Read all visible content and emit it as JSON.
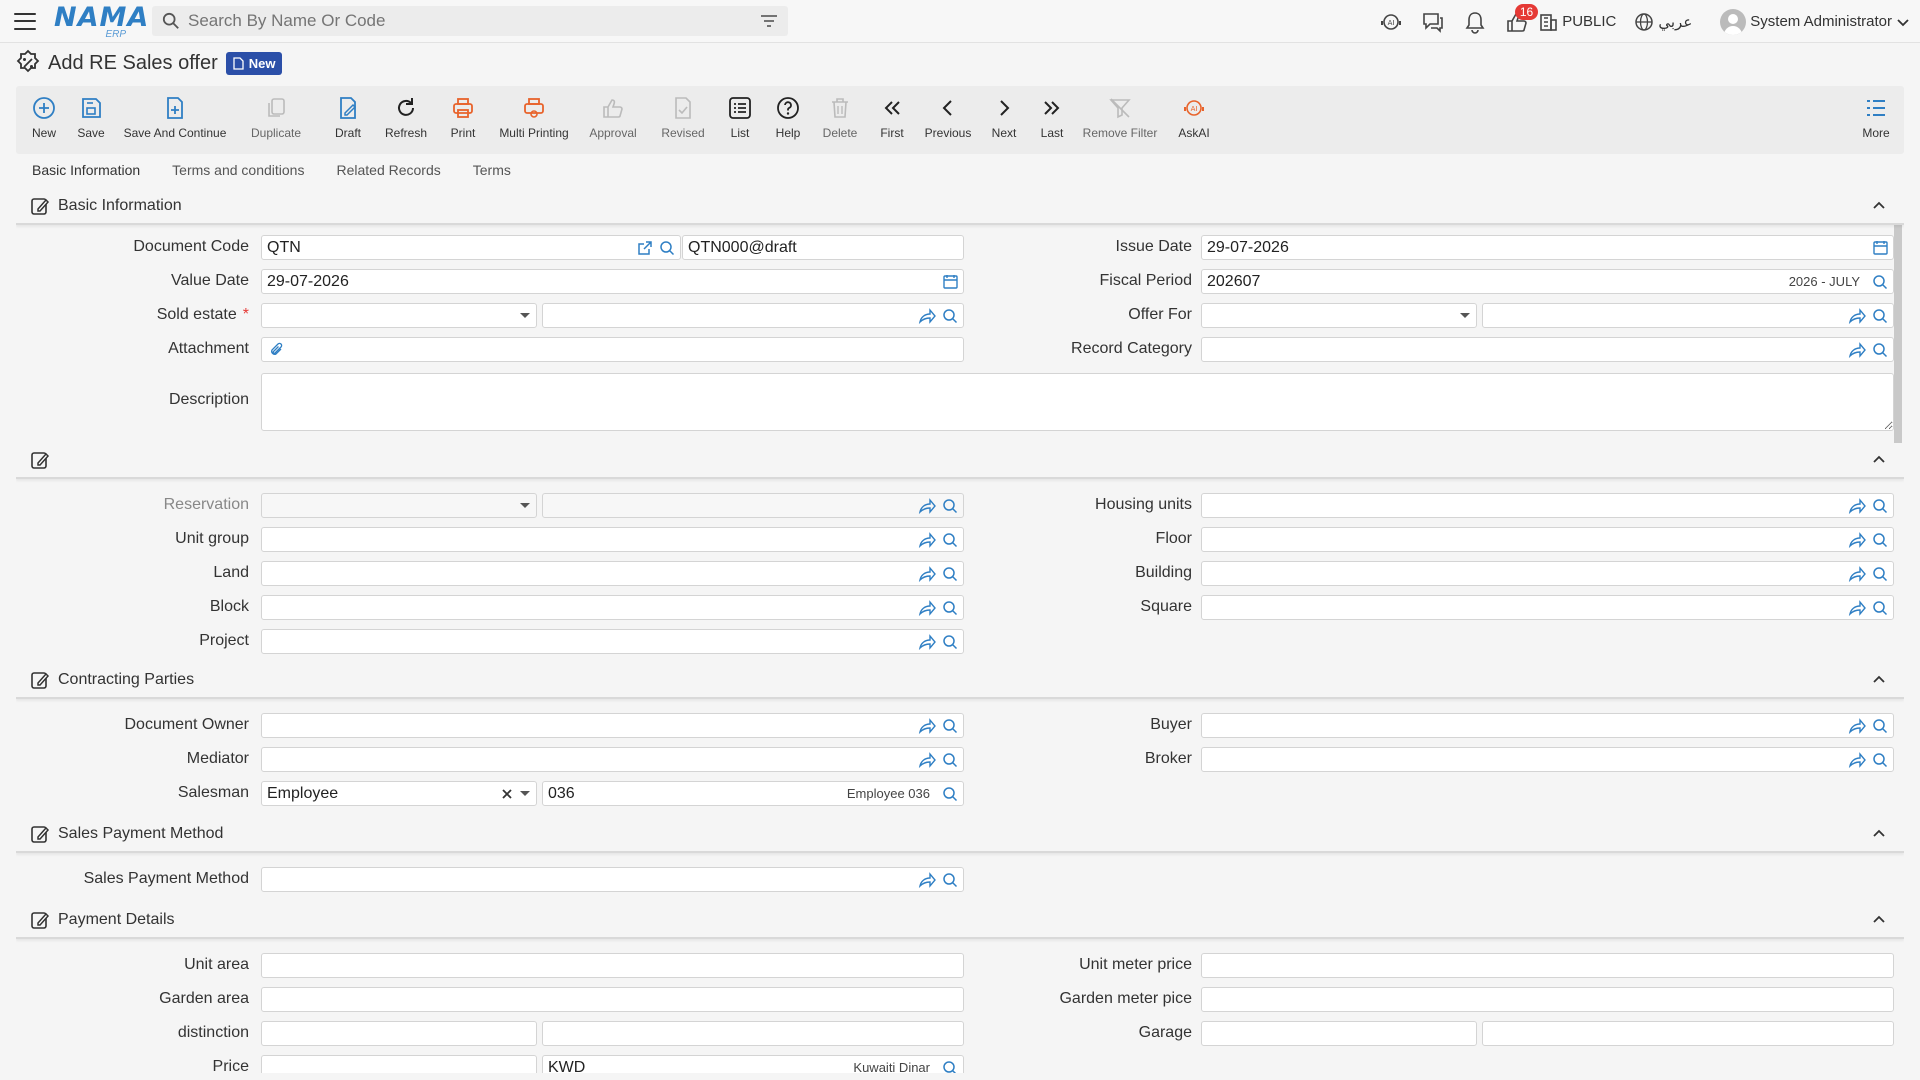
{
  "header": {
    "logo_text": "NAMA",
    "logo_sub": "ERP",
    "search_placeholder": "Search By Name Or Code",
    "notification_count": "16",
    "company": "PUBLIC",
    "language": "عربي",
    "user": "System Administrator"
  },
  "page": {
    "title": "Add RE Sales offer",
    "status_badge": "New"
  },
  "toolbar": [
    {
      "label": "New",
      "icon": "plus-circle-icon"
    },
    {
      "label": "Save",
      "icon": "save-icon"
    },
    {
      "label": "Save And Continue",
      "icon": "save-continue-icon"
    },
    {
      "label": "Duplicate",
      "icon": "duplicate-icon"
    },
    {
      "label": "Draft",
      "icon": "draft-icon"
    },
    {
      "label": "Refresh",
      "icon": "refresh-icon"
    },
    {
      "label": "Print",
      "icon": "print-icon"
    },
    {
      "label": "Multi Printing",
      "icon": "multi-print-icon"
    },
    {
      "label": "Approval",
      "icon": "approval-icon"
    },
    {
      "label": "Revised",
      "icon": "revised-icon"
    },
    {
      "label": "List",
      "icon": "list-icon"
    },
    {
      "label": "Help",
      "icon": "help-icon"
    },
    {
      "label": "Delete",
      "icon": "delete-icon"
    },
    {
      "label": "First",
      "icon": "first-icon"
    },
    {
      "label": "Previous",
      "icon": "previous-icon"
    },
    {
      "label": "Next",
      "icon": "next-icon"
    },
    {
      "label": "Last",
      "icon": "last-icon"
    },
    {
      "label": "Remove Filter",
      "icon": "remove-filter-icon"
    },
    {
      "label": "AskAI",
      "icon": "ai-icon"
    },
    {
      "label": "More",
      "icon": "more-icon"
    }
  ],
  "tabs": [
    "Basic Information",
    "Terms and conditions",
    "Related Records",
    "Terms"
  ],
  "sections": {
    "basic": "Basic Information",
    "contracting": "Contracting Parties",
    "sales_payment": "Sales Payment Method",
    "payment_details": "Payment Details"
  },
  "basic": {
    "document_code_label": "Document Code",
    "document_code": "QTN",
    "document_code2": "QTN000@draft",
    "issue_date_label": "Issue Date",
    "issue_date": "29-07-2026",
    "value_date_label": "Value Date",
    "value_date": "29-07-2026",
    "fiscal_period_label": "Fiscal Period",
    "fiscal_period": "202607",
    "fiscal_period_tag": "2026 - JULY",
    "sold_estate_label": "Sold estate",
    "offer_for_label": "Offer For",
    "attachment_label": "Attachment",
    "record_category_label": "Record Category",
    "description_label": "Description"
  },
  "units": {
    "reservation_label": "Reservation",
    "housing_units_label": "Housing units",
    "unit_group_label": "Unit group",
    "floor_label": "Floor",
    "land_label": "Land",
    "building_label": "Building",
    "block_label": "Block",
    "square_label": "Square",
    "project_label": "Project"
  },
  "parties": {
    "document_owner_label": "Document Owner",
    "buyer_label": "Buyer",
    "mediator_label": "Mediator",
    "broker_label": "Broker",
    "salesman_label": "Salesman",
    "salesman_type": "Employee",
    "salesman_code": "036",
    "salesman_name": "Employee 036"
  },
  "payment_method": {
    "label": "Sales Payment Method"
  },
  "payment_details": {
    "unit_area_label": "Unit area",
    "unit_meter_price_label": "Unit meter price",
    "garden_area_label": "Garden area",
    "garden_meter_price_label": "Garden meter pice",
    "distinction_label": "distinction",
    "garage_label": "Garage",
    "price_label": "Price",
    "currency_code": "KWD",
    "currency_name": "Kuwaiti Dinar"
  }
}
